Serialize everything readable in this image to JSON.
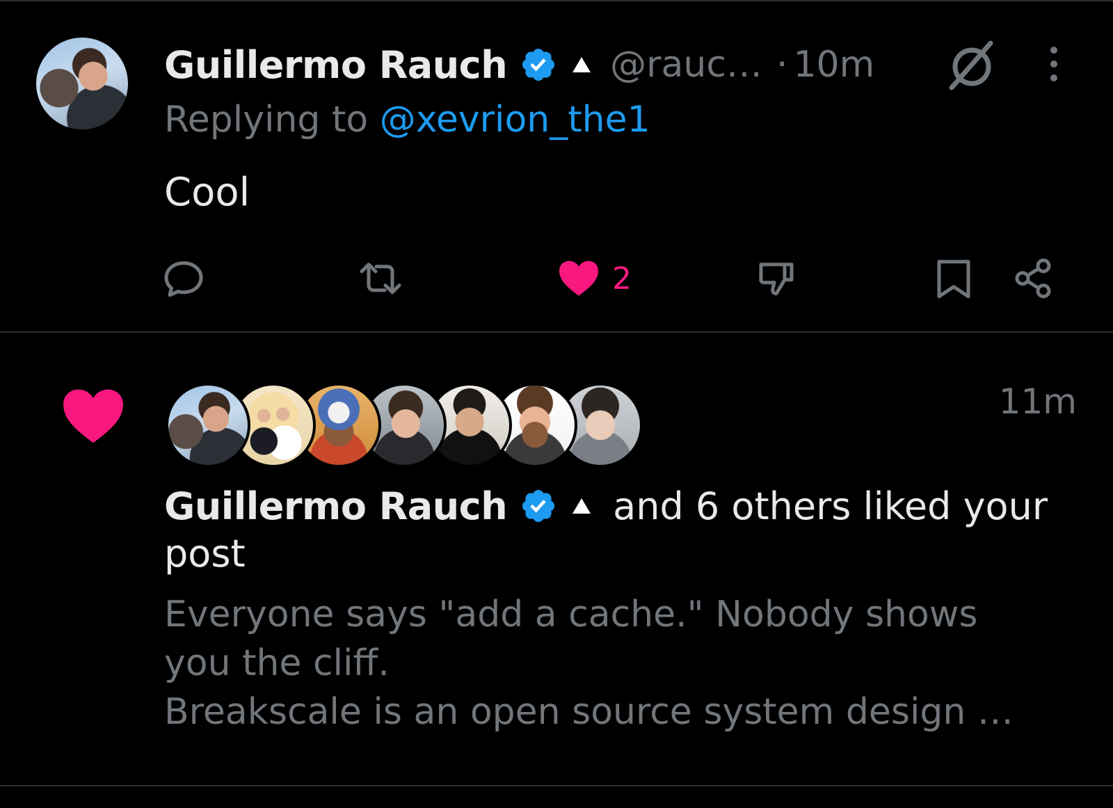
{
  "post": {
    "author_name": "Guillermo Rauch",
    "handle": "@rauc…",
    "separator": "·",
    "time": "10m",
    "replying_prefix": "Replying to ",
    "replying_to": "@xevrion_the1",
    "text": "Cool",
    "like_count": "2",
    "icons": [
      "reply-icon",
      "repost-icon",
      "like-icon",
      "dislike-icon",
      "bookmark-icon",
      "share-icon"
    ]
  },
  "notification": {
    "time": "11m",
    "actor_name": "Guillermo Rauch",
    "liked_text": "and 6 others liked your",
    "liked_text_cont": "post",
    "avatars_count": 7,
    "snippet_lines": [
      "Everyone says \"add a cache.\" Nobody shows",
      "you the cliff.",
      "Breakscale is an open source system design …"
    ]
  },
  "colors": {
    "background": "#000000",
    "text": "#e7e9ea",
    "muted": "#71767b",
    "link": "#1d9bf0",
    "like": "#f91880",
    "verified": "#1d9bf0"
  }
}
